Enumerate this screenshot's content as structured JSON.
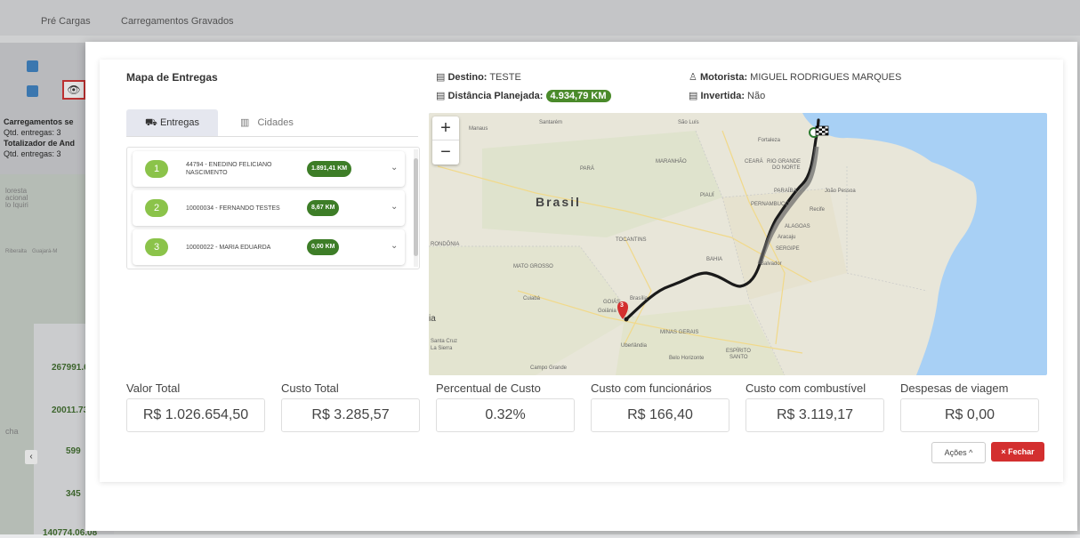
{
  "background": {
    "tabs": [
      "Pré Cargas",
      "Carregamentos Gravados"
    ],
    "side_lines": [
      "Carregamentos se",
      "Qtd. entregas: 3",
      "Totalizador de And",
      "Qtd. entregas: 3"
    ],
    "map_labels": [
      "loresta",
      "acional",
      "lo Iquiri",
      "Riberalta",
      "Guajará-M",
      "cha"
    ],
    "metrics": [
      "267991.6",
      "20011.73",
      "599",
      "345",
      "140774.06.08"
    ]
  },
  "modal": {
    "title": "Mapa de Entregas",
    "destino_label": "Destino:",
    "destino_value": "TESTE",
    "distancia_label": "Distância Planejada:",
    "distancia_value": "4.934,79 KM",
    "motorista_label": "Motorista:",
    "motorista_value": "MIGUEL RODRIGUES MARQUES",
    "invertida_label": "Invertida:",
    "invertida_value": "Não",
    "tabs": [
      {
        "label": "Entregas",
        "icon": "truck-icon"
      },
      {
        "label": "Cidades",
        "icon": "city-icon"
      }
    ],
    "deliveries": [
      {
        "num": "1",
        "name": "44794 - ENEDINO FELICIANO NASCIMENTO",
        "km": "1.891,41 KM"
      },
      {
        "num": "2",
        "name": "10000034 - FERNANDO TESTES",
        "km": "8,67 KM"
      },
      {
        "num": "3",
        "name": "10000022 - MARIA EDUARDA",
        "km": "0,00 KM"
      }
    ],
    "map": {
      "zoom_in": "+",
      "zoom_out": "−",
      "labels": {
        "brasil": "Brasil",
        "manaus": "Manaus",
        "santarem": "Santarém",
        "sao_luis": "São Luís",
        "fortaleza": "Fortaleza",
        "para": "PARÁ",
        "maranhao": "MARANHÃO",
        "ceara": "CEARÁ",
        "rgn1": "RIO GRANDE",
        "rgn2": "DO NORTE",
        "paraiba": "PARAÍBA",
        "joao_pessoa": "João Pessoa",
        "piaui": "PIAUÍ",
        "pernambuco": "PERNAMBUCO",
        "recife": "Recife",
        "alagoas": "ALAGOAS",
        "aracaju": "Aracaju",
        "sergipe": "SERGIPE",
        "salvador": "Salvador",
        "bahia": "BAHIA",
        "tocantins": "TOCANTINS",
        "rondonia": "RONDÔNIA",
        "mato_grosso": "MATO GROSSO",
        "cuiaba": "Cuiabá",
        "goias": "GOIÁS",
        "brasilia": "Brasília",
        "goiania": "Goiânia",
        "minas_gerais": "MINAS GERAIS",
        "uberlandia": "Uberlândia",
        "belo_horizonte": "Belo Horizonte",
        "espirito": "ESPÍRITO",
        "santo": "SANTO",
        "campo_grande": "Campo Grande",
        "santa_cruz1": "Santa Cruz",
        "santa_cruz2": "La Sierra",
        "bolivia": "ia",
        "marker_num": "3"
      }
    },
    "metrics": [
      {
        "label": "Valor Total",
        "value": "R$ 1.026.654,50"
      },
      {
        "label": "Custo Total",
        "value": "R$ 3.285,57"
      },
      {
        "label": "Percentual de Custo",
        "value": "0.32%"
      },
      {
        "label": "Custo com funcionários",
        "value": "R$ 166,40"
      },
      {
        "label": "Custo com combustível",
        "value": "R$ 3.119,17"
      },
      {
        "label": "Despesas de viagem",
        "value": "R$ 0,00"
      }
    ],
    "acoes_label": "Ações ^",
    "fechar_label": "× Fechar"
  }
}
